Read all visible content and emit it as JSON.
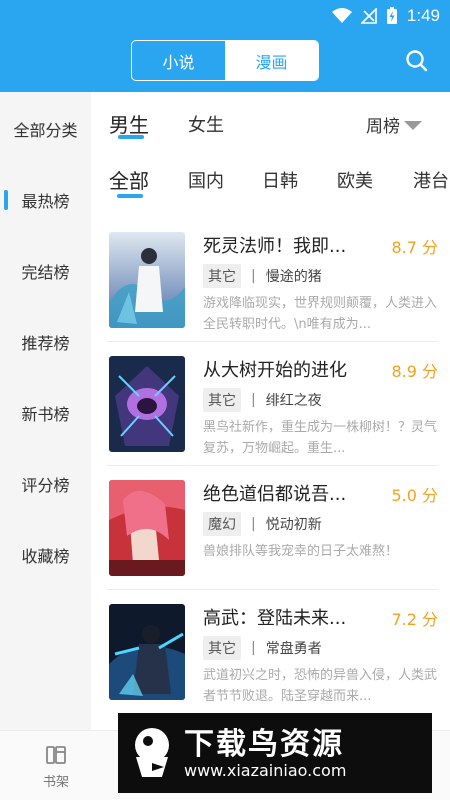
{
  "status_bar": {
    "time": "1:49"
  },
  "header": {
    "segments": [
      "小说",
      "漫画"
    ],
    "active_segment": "漫画"
  },
  "sidebar": {
    "items": [
      "全部分类",
      "最热榜",
      "完结榜",
      "推荐榜",
      "新书榜",
      "评分榜",
      "收藏榜"
    ],
    "active": "最热榜"
  },
  "gender_tabs": {
    "items": [
      "男生",
      "女生"
    ],
    "active": "男生"
  },
  "rank_period": "周榜",
  "region_tabs": {
    "items": [
      "全部",
      "国内",
      "日韩",
      "欧美",
      "港台"
    ],
    "active": "全部"
  },
  "books": [
    {
      "title": "死灵法师！我即...",
      "score": "8.7 分",
      "tag": "其它",
      "author": "慢途的猪",
      "desc": "游戏降临现实，世界规则颠覆，人类进入全民转职时代。\\n唯有成为..."
    },
    {
      "title": "从大树开始的进化",
      "score": "8.9 分",
      "tag": "其它",
      "author": "绯红之夜",
      "desc": "黑鸟社新作，重生成为一株柳树！？灵气复苏，万物崛起。重生..."
    },
    {
      "title": "绝色道侣都说吾...",
      "score": "5.0 分",
      "tag": "魔幻",
      "author": "悦动初新",
      "desc": "兽娘排队等我宠幸的日子太难熬！"
    },
    {
      "title": "高武：登陆未来...",
      "score": "7.2 分",
      "tag": "其它",
      "author": "常盘勇者",
      "desc": "武道初兴之时，恐怖的异兽入侵，人类武者节节败退。陆圣穿越而来..."
    }
  ],
  "bottom_nav": {
    "shelf_label": "书架"
  },
  "watermark": {
    "text_cn": "下载鸟资源",
    "url": "www.xiazainiao.com"
  },
  "colors": {
    "accent": "#2aa5f0",
    "score": "#f4a21e"
  }
}
